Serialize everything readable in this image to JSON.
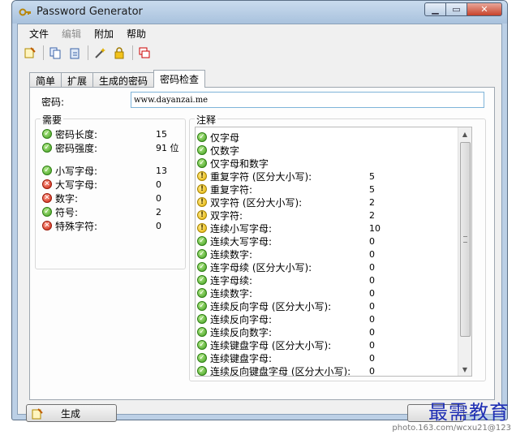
{
  "window": {
    "title": "Password Generator"
  },
  "menu": [
    {
      "label": "文件",
      "enabled": true
    },
    {
      "label": "编辑",
      "enabled": false
    },
    {
      "label": "附加",
      "enabled": true
    },
    {
      "label": "帮助",
      "enabled": true
    }
  ],
  "toolbar": [
    "new-icon",
    "copy-icon",
    "paste-icon",
    "wizard-icon",
    "lock-icon",
    "windows-icon"
  ],
  "tabs": [
    {
      "label": "简单",
      "active": false
    },
    {
      "label": "扩展",
      "active": false
    },
    {
      "label": "生成的密码",
      "active": false
    },
    {
      "label": "密码检查",
      "active": true
    }
  ],
  "password": {
    "label": "密码:",
    "value": "www.dayanzai.me"
  },
  "requirements": {
    "title": "需要",
    "rows": [
      {
        "label": "密码长度:",
        "value": "15",
        "status": "ok"
      },
      {
        "label": "密码强度:",
        "value": "91 位",
        "status": "ok"
      },
      {
        "label": "小写字母:",
        "value": "13",
        "status": "ok"
      },
      {
        "label": "大写字母:",
        "value": "0",
        "status": "bad"
      },
      {
        "label": "数字:",
        "value": "0",
        "status": "bad"
      },
      {
        "label": "符号:",
        "value": "2",
        "status": "ok"
      },
      {
        "label": "特殊字符:",
        "value": "0",
        "status": "bad"
      }
    ]
  },
  "notes": {
    "title": "注释",
    "rows": [
      {
        "label": "仅字母",
        "value": "",
        "status": "ok"
      },
      {
        "label": "仅数字",
        "value": "",
        "status": "ok"
      },
      {
        "label": "仅字母和数字",
        "value": "",
        "status": "ok"
      },
      {
        "label": "重复字符 (区分大小写):",
        "value": "5",
        "status": "warn"
      },
      {
        "label": "重复字符:",
        "value": "5",
        "status": "warn"
      },
      {
        "label": "双字符 (区分大小写):",
        "value": "2",
        "status": "warn"
      },
      {
        "label": "双字符:",
        "value": "2",
        "status": "warn"
      },
      {
        "label": "连续小写字母:",
        "value": "10",
        "status": "warn"
      },
      {
        "label": "连续大写字母:",
        "value": "0",
        "status": "ok"
      },
      {
        "label": "连续数字:",
        "value": "0",
        "status": "ok"
      },
      {
        "label": "连字母续 (区分大小写):",
        "value": "0",
        "status": "ok"
      },
      {
        "label": "连字母续:",
        "value": "0",
        "status": "ok"
      },
      {
        "label": "连续数字:",
        "value": "0",
        "status": "ok"
      },
      {
        "label": "连续反向字母 (区分大小写):",
        "value": "0",
        "status": "ok"
      },
      {
        "label": "连续反向字母:",
        "value": "0",
        "status": "ok"
      },
      {
        "label": "连续反向数字:",
        "value": "0",
        "status": "ok"
      },
      {
        "label": "连续键盘字母 (区分大小写):",
        "value": "0",
        "status": "ok"
      },
      {
        "label": "连续键盘字母:",
        "value": "0",
        "status": "ok"
      },
      {
        "label": "连续反向键盘字母 (区分大小写):",
        "value": "0",
        "status": "ok"
      }
    ]
  },
  "buttons": {
    "generate": "生成"
  },
  "watermark": {
    "text": "最需教育",
    "url": "photo.163.com/wcxu21@123"
  }
}
